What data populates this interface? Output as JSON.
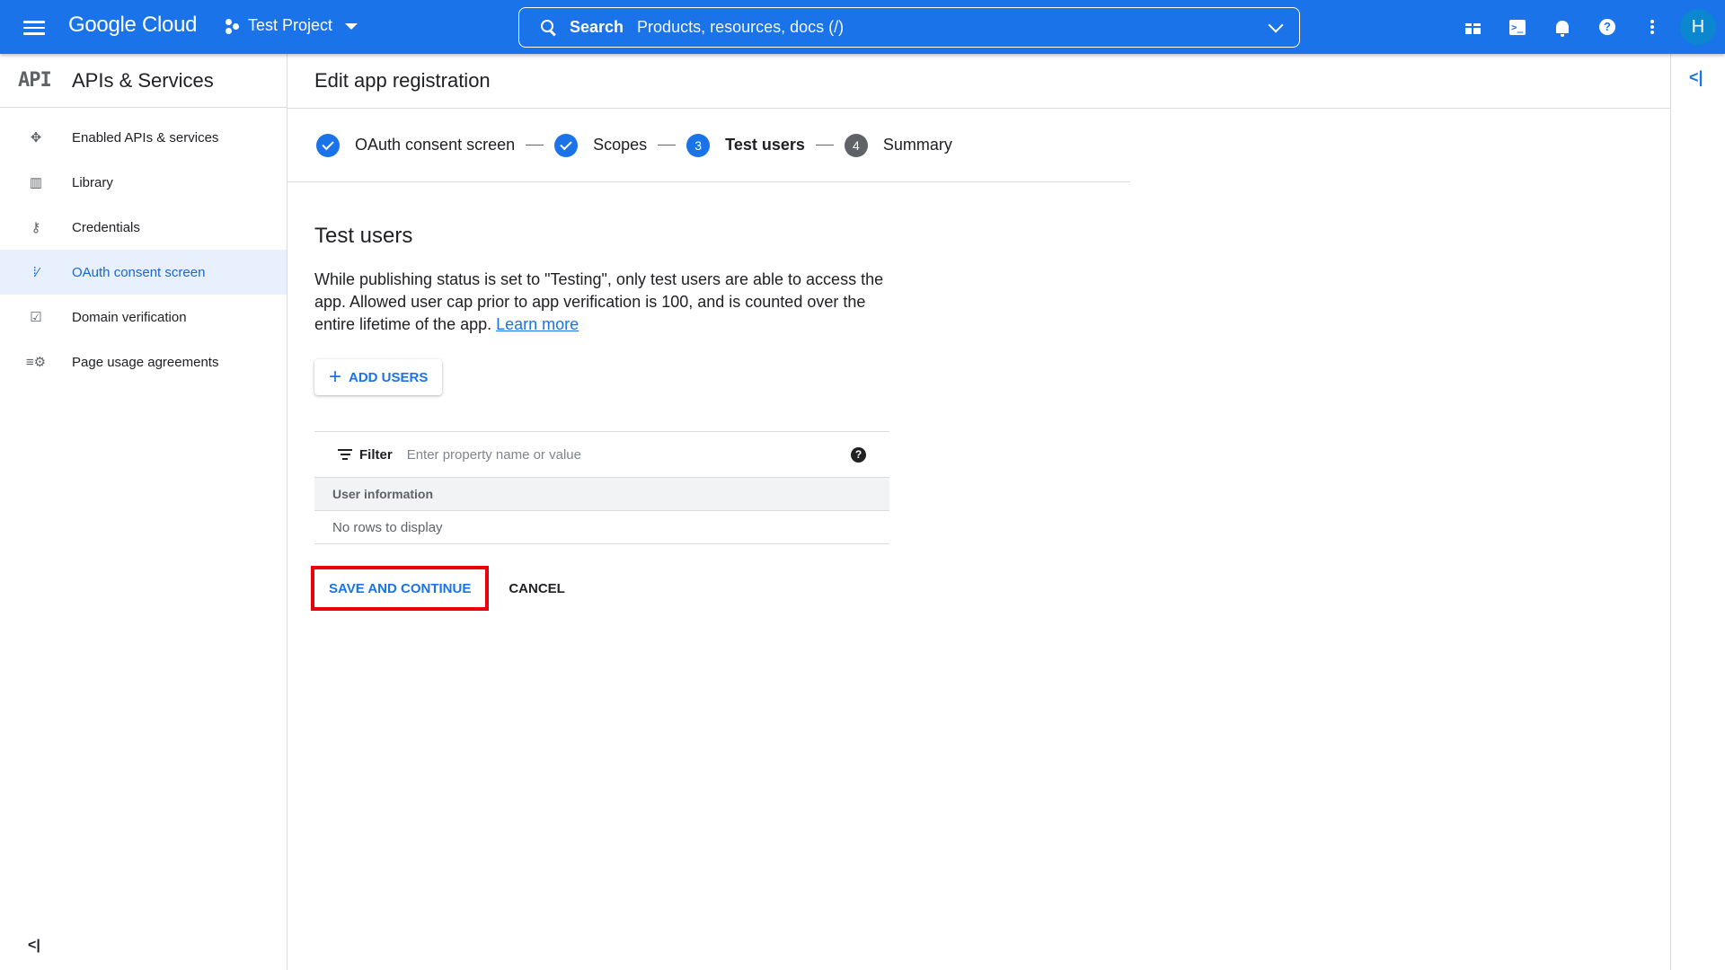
{
  "topbar": {
    "brand": "Google Cloud",
    "project": "Test Project",
    "search_label": "Search",
    "search_placeholder": "Products, resources, docs (/)",
    "avatar_initial": "H",
    "icons": [
      "gift-icon",
      "cloud-shell-icon",
      "notifications-icon",
      "help-icon",
      "more-vert-icon"
    ]
  },
  "sidebar": {
    "logo_text": "API",
    "title": "APIs & Services",
    "items": [
      {
        "label": "Enabled APIs & services",
        "icon": "✥"
      },
      {
        "label": "Library",
        "icon": "▥"
      },
      {
        "label": "Credentials",
        "icon": "⚷"
      },
      {
        "label": "OAuth consent screen",
        "icon": "⁞⁄",
        "active": true
      },
      {
        "label": "Domain verification",
        "icon": "☑"
      },
      {
        "label": "Page usage agreements",
        "icon": "≡⚙"
      }
    ],
    "collapse_icon": "<|"
  },
  "right_panel": {
    "expand_icon": "<|"
  },
  "main": {
    "page_title": "Edit app registration",
    "steps": [
      {
        "label": "OAuth consent screen",
        "state": "done"
      },
      {
        "label": "Scopes",
        "state": "done"
      },
      {
        "label": "Test users",
        "number": "3",
        "state": "current"
      },
      {
        "label": "Summary",
        "number": "4",
        "state": "todo"
      }
    ],
    "section_title": "Test users",
    "description": "While publishing status is set to \"Testing\", only test users are able to access the app. Allowed user cap prior to app verification is 100, and is counted over the entire lifetime of the app.",
    "learn_more": "Learn more",
    "add_users_label": "ADD USERS",
    "filter_label": "Filter",
    "filter_placeholder": "Enter property name or value",
    "filter_value": "",
    "table_header": "User information",
    "empty_message": "No rows to display",
    "save_label": "SAVE AND CONTINUE",
    "cancel_label": "CANCEL"
  },
  "colors": {
    "brand_blue": "#1a73e8",
    "highlight_red": "#e8000b",
    "active_bg": "#e8f0fe"
  }
}
